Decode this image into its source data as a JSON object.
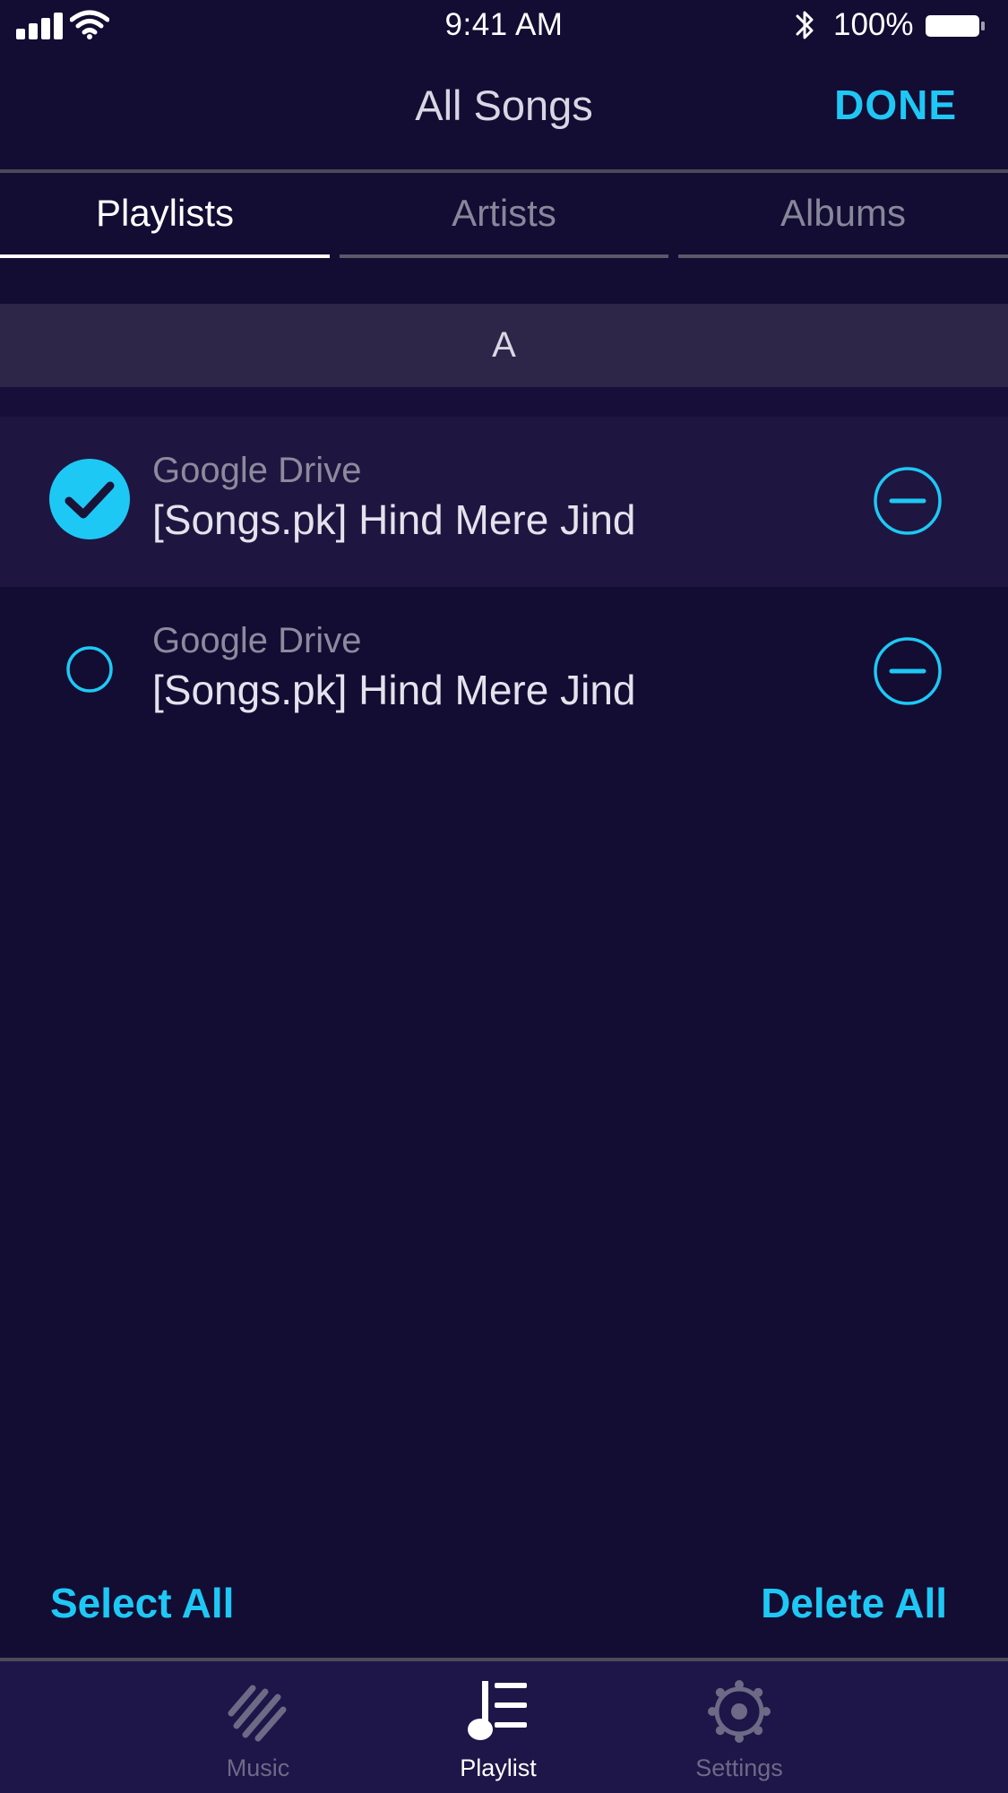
{
  "status_bar": {
    "time": "9:41 AM",
    "battery_percent": "100%",
    "signal_bars": 4
  },
  "nav": {
    "title": "All Songs",
    "done_label": "DONE"
  },
  "tabs": [
    {
      "label": "Playlists",
      "active": true
    },
    {
      "label": "Artists",
      "active": false
    },
    {
      "label": "Albums",
      "active": false
    }
  ],
  "section": {
    "letter": "A"
  },
  "songs": [
    {
      "source": "Google Drive",
      "title": "[Songs.pk] Hind Mere Jind",
      "selected": true
    },
    {
      "source": "Google Drive",
      "title": "[Songs.pk] Hind Mere Jind",
      "selected": false
    }
  ],
  "actions": {
    "select_all": "Select All",
    "delete_all": "Delete All"
  },
  "tab_bar": [
    {
      "label": "Music",
      "icon": "music-bars-icon",
      "active": false
    },
    {
      "label": "Playlist",
      "icon": "playlist-icon",
      "active": true
    },
    {
      "label": "Settings",
      "icon": "gear-icon",
      "active": false
    }
  ],
  "colors": {
    "background": "#130c33",
    "accent": "#1ec8f5",
    "section_header": "#2d2649",
    "selected_row": "#1e1640",
    "tab_bar": "#1e1649"
  }
}
